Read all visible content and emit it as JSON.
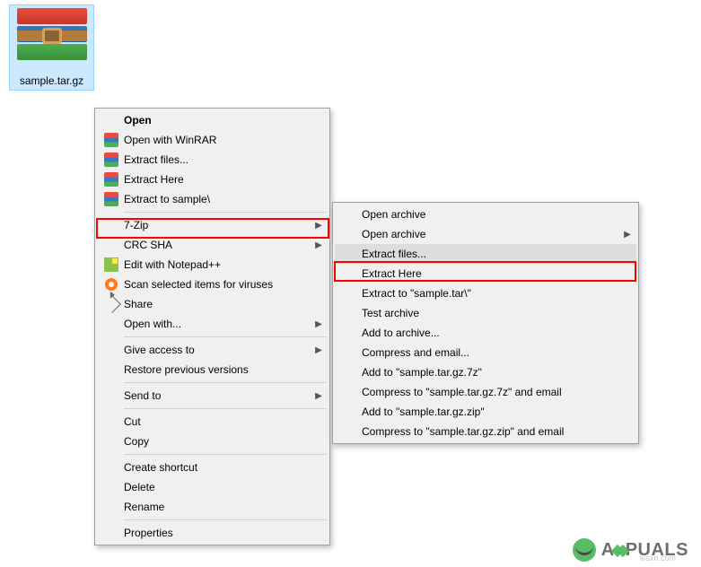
{
  "file": {
    "name": "sample.tar.gz"
  },
  "context_menu": {
    "items": [
      {
        "label": "Open",
        "bold": true
      },
      {
        "label": "Open with WinRAR",
        "icon": "winrar"
      },
      {
        "label": "Extract files...",
        "icon": "winrar"
      },
      {
        "label": "Extract Here",
        "icon": "winrar"
      },
      {
        "label": "Extract to sample\\",
        "icon": "winrar"
      },
      {
        "sep": true
      },
      {
        "label": "7-Zip",
        "submenu": true,
        "highlighted": true
      },
      {
        "label": "CRC SHA",
        "submenu": true
      },
      {
        "label": "Edit with Notepad++",
        "icon": "notepadpp"
      },
      {
        "label": "Scan selected items for viruses",
        "icon": "avast"
      },
      {
        "label": "Share",
        "icon": "share"
      },
      {
        "label": "Open with...",
        "submenu": true
      },
      {
        "sep": true
      },
      {
        "label": "Give access to",
        "submenu": true
      },
      {
        "label": "Restore previous versions"
      },
      {
        "sep": true
      },
      {
        "label": "Send to",
        "submenu": true
      },
      {
        "sep": true
      },
      {
        "label": "Cut"
      },
      {
        "label": "Copy"
      },
      {
        "sep": true
      },
      {
        "label": "Create shortcut"
      },
      {
        "label": "Delete"
      },
      {
        "label": "Rename"
      },
      {
        "sep": true
      },
      {
        "label": "Properties"
      }
    ]
  },
  "submenu_7zip": {
    "items": [
      {
        "label": "Open archive"
      },
      {
        "label": "Open archive",
        "submenu": true
      },
      {
        "label": "Extract files...",
        "highlighted": true,
        "selected": true
      },
      {
        "label": "Extract Here"
      },
      {
        "label": "Extract to \"sample.tar\\\""
      },
      {
        "label": "Test archive"
      },
      {
        "label": "Add to archive..."
      },
      {
        "label": "Compress and email..."
      },
      {
        "label": "Add to \"sample.tar.gz.7z\""
      },
      {
        "label": "Compress to \"sample.tar.gz.7z\" and email"
      },
      {
        "label": "Add to \"sample.tar.gz.zip\""
      },
      {
        "label": "Compress to \"sample.tar.gz.zip\" and email"
      }
    ]
  },
  "watermark": {
    "brand_before": "A",
    "brand_after": "PUALS",
    "site": "wsxn.com"
  }
}
